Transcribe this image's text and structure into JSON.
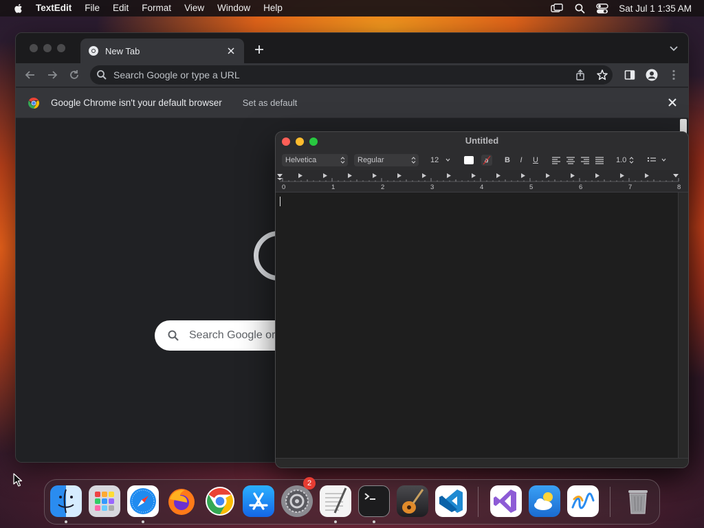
{
  "menubar": {
    "app_name": "TextEdit",
    "menus": [
      "File",
      "Edit",
      "Format",
      "View",
      "Window",
      "Help"
    ],
    "clock": "Sat Jul 1  1:35 AM"
  },
  "chrome": {
    "tab_title": "New Tab",
    "omnibox_placeholder": "Search Google or type a URL",
    "infobar_message": "Google Chrome isn't your default browser",
    "infobar_action": "Set as default",
    "ntp_search_text": "Search Google or type a URL"
  },
  "textedit": {
    "title": "Untitled",
    "font_family": "Helvetica",
    "font_style": "Regular",
    "font_size": "12",
    "bold": "B",
    "italic": "I",
    "underline": "U",
    "line_spacing": "1.0",
    "ruler_numbers": [
      "0",
      "1",
      "2",
      "3",
      "4",
      "5",
      "6",
      "7",
      "8"
    ]
  },
  "dock": {
    "apps": [
      "Finder",
      "Launchpad",
      "Safari",
      "Firefox",
      "Google Chrome",
      "App Store",
      "System Settings",
      "TextEdit",
      "Terminal",
      "GarageBand",
      "Visual Studio Code",
      "Visual Studio",
      "Weather",
      "Freeform",
      "Trash"
    ],
    "settings_badge": "2"
  },
  "colors": {
    "close": "#ff5f57",
    "minimize": "#febc2e",
    "zoom": "#28c840",
    "chrome_toolbar": "#35363a",
    "editor_bg": "#1e1e1e"
  }
}
